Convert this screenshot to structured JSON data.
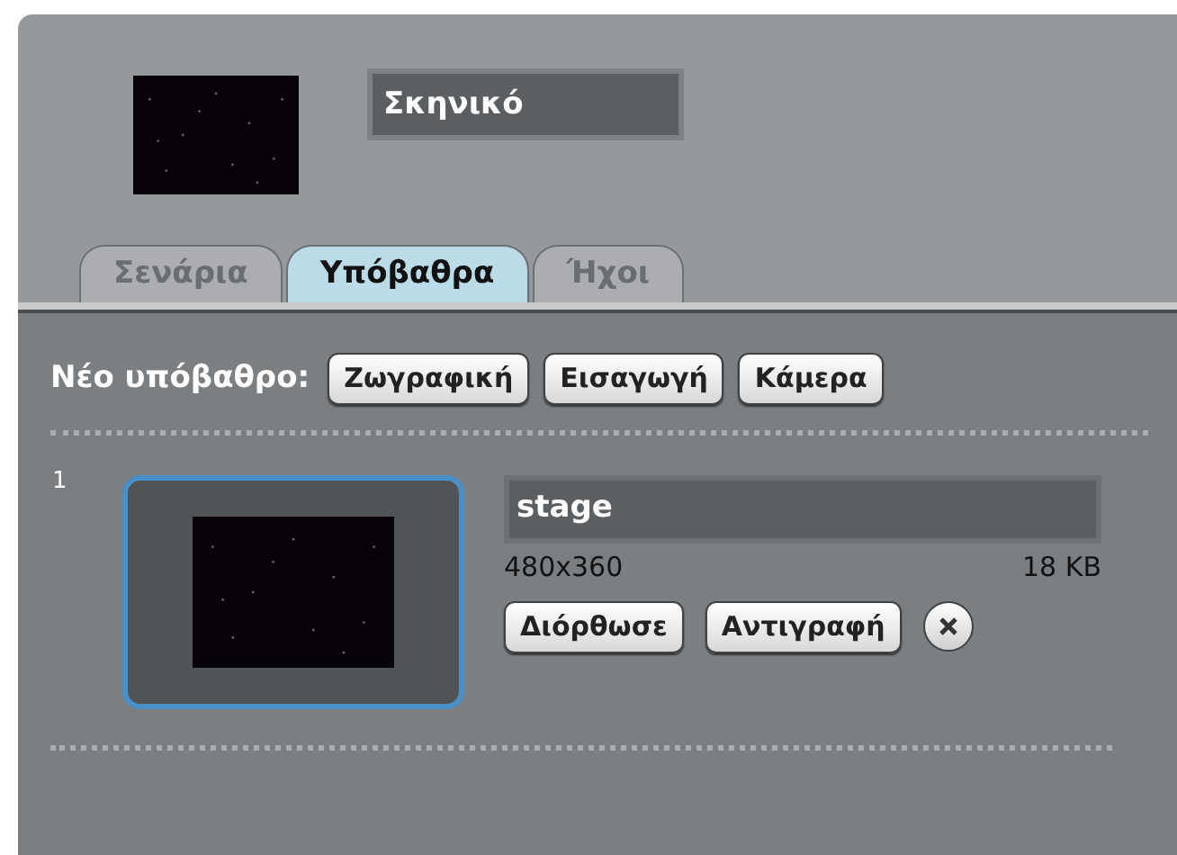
{
  "sprite": {
    "name": "Σκηνικό"
  },
  "tabs": [
    {
      "label": "Σενάρια",
      "selected": false
    },
    {
      "label": "Υπόβαθρα",
      "selected": true
    },
    {
      "label": "Ήχοι",
      "selected": false
    }
  ],
  "new_backdrop": {
    "label": "Νέο υπόβαθρο:",
    "buttons": [
      "Ζωγραφική",
      "Εισαγωγή",
      "Κάμερα"
    ]
  },
  "backdrops": [
    {
      "number": "1",
      "name": "stage",
      "size": "480x360",
      "file_size": "18 KB",
      "selected": true,
      "buttons": [
        "Διόρθωσε",
        "Αντιγραφή"
      ]
    }
  ]
}
